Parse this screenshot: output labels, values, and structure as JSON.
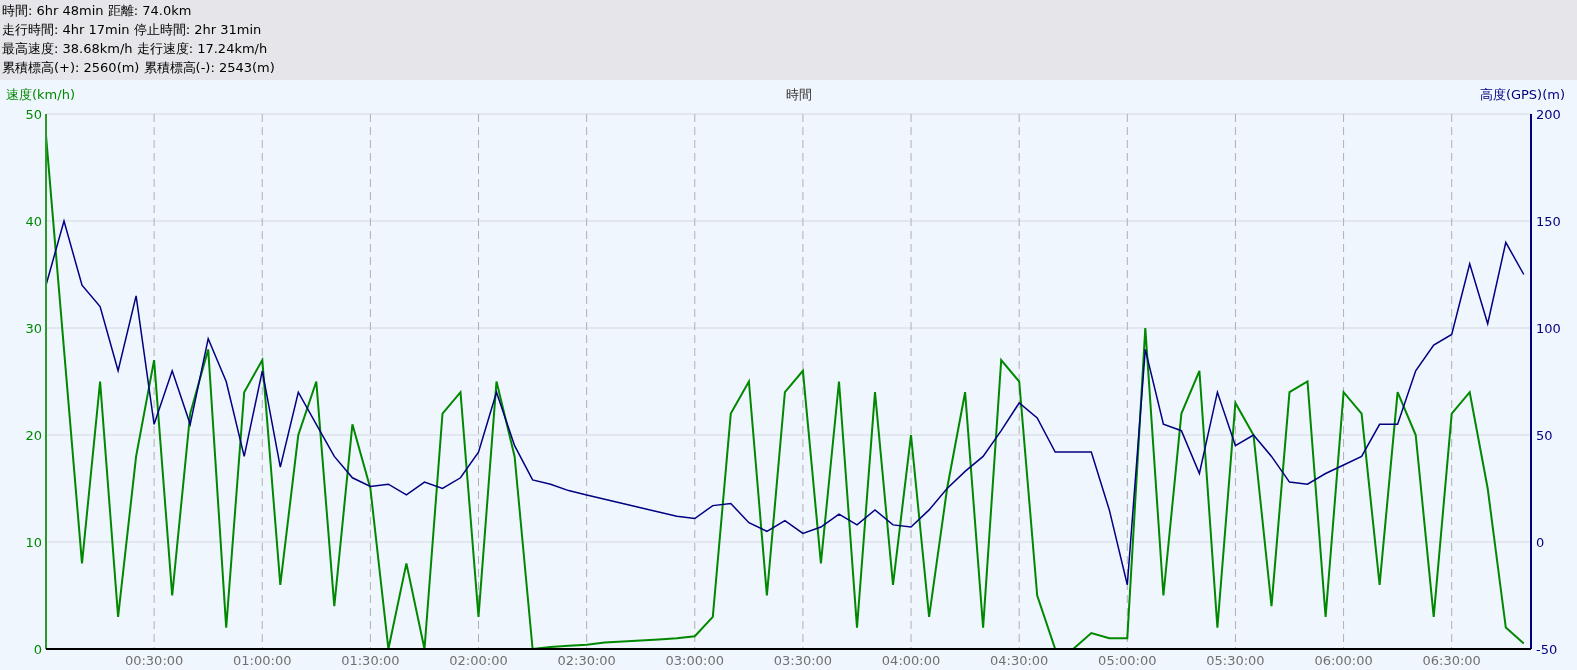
{
  "summary": {
    "lines": [
      "時間: 6hr 48min 距離: 74.0km",
      "走行時間: 4hr 17min 停止時間: 2hr 31min",
      "最高速度: 38.68km/h 走行速度: 17.24km/h",
      "累積標高(+): 2560(m) 累積標高(-): 2543(m)"
    ]
  },
  "chart": {
    "chart_data": {
      "type": "line",
      "xlabel": "時間",
      "grid": true,
      "xlim": [
        0,
        412
      ],
      "ylim": [
        0,
        50
      ],
      "y2lim": [
        -50,
        200
      ],
      "xticks": [
        {
          "value": 30,
          "label": "00:30:00"
        },
        {
          "value": 60,
          "label": "01:00:00"
        },
        {
          "value": 90,
          "label": "01:30:00"
        },
        {
          "value": 120,
          "label": "02:00:00"
        },
        {
          "value": 150,
          "label": "02:30:00"
        },
        {
          "value": 180,
          "label": "03:00:00"
        },
        {
          "value": 210,
          "label": "03:30:00"
        },
        {
          "value": 240,
          "label": "04:00:00"
        },
        {
          "value": 270,
          "label": "04:30:00"
        },
        {
          "value": 300,
          "label": "05:00:00"
        },
        {
          "value": 330,
          "label": "05:30:00"
        },
        {
          "value": 360,
          "label": "06:00:00"
        },
        {
          "value": 390,
          "label": "06:30:00"
        }
      ],
      "yticks": [
        0,
        10,
        20,
        30,
        40,
        50
      ],
      "y2ticks": [
        -50,
        0,
        50,
        100,
        150,
        200
      ],
      "x": [
        0,
        5,
        10,
        15,
        20,
        25,
        30,
        35,
        40,
        45,
        50,
        55,
        60,
        65,
        70,
        75,
        80,
        85,
        90,
        95,
        100,
        105,
        110,
        115,
        120,
        125,
        130,
        135,
        140,
        145,
        150,
        155,
        160,
        165,
        170,
        175,
        180,
        185,
        190,
        195,
        200,
        205,
        210,
        215,
        220,
        225,
        230,
        235,
        240,
        245,
        250,
        255,
        260,
        265,
        270,
        275,
        280,
        285,
        290,
        295,
        300,
        305,
        310,
        315,
        320,
        325,
        330,
        335,
        340,
        345,
        350,
        355,
        360,
        365,
        370,
        375,
        380,
        385,
        390,
        395,
        400,
        405,
        410
      ],
      "series": [
        {
          "name": "速度(km/h)",
          "color": "#008800",
          "values": [
            48,
            28,
            8,
            25,
            3,
            18,
            27,
            5,
            22,
            28,
            2,
            24,
            27,
            6,
            20,
            25,
            4,
            21,
            15,
            0,
            8,
            0,
            22,
            24,
            3,
            25,
            18,
            0,
            0.2,
            0.3,
            0.4,
            0.6,
            0.7,
            0.8,
            0.9,
            1,
            1.2,
            3,
            22,
            25,
            5,
            24,
            26,
            8,
            25,
            2,
            24,
            6,
            20,
            3,
            15,
            24,
            2,
            27,
            25,
            5,
            0,
            0,
            1.5,
            1,
            1,
            30,
            5,
            22,
            26,
            2,
            23,
            20,
            4,
            24,
            25,
            3,
            24,
            22,
            6,
            24,
            20,
            3,
            22,
            24,
            15,
            2,
            0.5
          ]
        },
        {
          "name": "高度(GPS)(m)",
          "color": "#000080",
          "axis": "y2",
          "values": [
            120,
            150,
            120,
            110,
            80,
            115,
            55,
            80,
            55,
            95,
            75,
            40,
            80,
            35,
            70,
            55,
            40,
            30,
            26,
            27,
            22,
            28,
            25,
            30,
            42,
            70,
            45,
            29,
            27,
            24,
            22,
            20,
            18,
            16,
            14,
            12,
            11,
            17,
            18,
            9,
            5,
            10,
            4,
            7,
            13,
            8,
            15,
            8,
            7,
            15,
            25,
            33,
            40,
            52,
            65,
            58,
            42,
            42,
            42,
            15,
            -20,
            90,
            55,
            52,
            32,
            70,
            45,
            50,
            40,
            28,
            27,
            32,
            36,
            40,
            55,
            55,
            80,
            92,
            97,
            130,
            102,
            140,
            125
          ]
        }
      ]
    }
  }
}
